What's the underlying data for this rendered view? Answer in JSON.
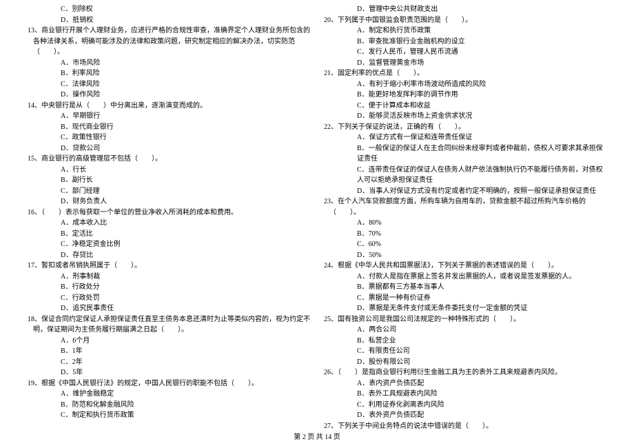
{
  "left": {
    "opts_pre": [
      "C．别除权",
      "D．抵销权"
    ],
    "q13": {
      "stem": "13、商业银行开展个人理财业务，应进行严格的合规性审查，准确界定个人理财业务所包含的各种法律关系，明确可能涉及的法律和政策问题，研究制定相应的解决办法，切实防范（　　）。",
      "opts": [
        "A．市场风险",
        "B．利率风险",
        "C．法律风险",
        "D．操作风险"
      ]
    },
    "q14": {
      "stem": "14、中央银行是从（　　）中分离出来，逐渐演变而成的。",
      "opts": [
        "A．早期银行",
        "B．现代商业银行",
        "C．政策性银行",
        "D．贷款公司"
      ]
    },
    "q15": {
      "stem": "15、商业银行的高级管理层不包括（　　）。",
      "opts": [
        "A．行长",
        "B．副行长",
        "C．部门经理",
        "D．财务负责人"
      ]
    },
    "q16": {
      "stem": "16、（　　）表示每获取一个单位的营业净收入所消耗的成本和费用。",
      "opts": [
        "A．成本收入比",
        "B．定活比",
        "C．净稳定资金比例",
        "D．存贷比"
      ]
    },
    "q17": {
      "stem": "17、暂扣或者吊销执照属于（　　）。",
      "opts": [
        "A．刑事制裁",
        "B．行政处分",
        "C．行政处罚",
        "D．追究民事责任"
      ]
    },
    "q18": {
      "stem": "18、保证合同约定保证人承担保证责任直至主债务本息还清时为止等类似内容的，视为约定不明，保证期间为主债务履行期届满之日起（　　）。",
      "opts": [
        "A．6个月",
        "B．1年",
        "C．2年",
        "D．5年"
      ]
    },
    "q19": {
      "stem": "19、根据《中国人民银行法》的规定，中国人民银行的职能不包括（　　）。",
      "opts": [
        "A．维护金融稳定",
        "B．防范和化解金融风险",
        "C．制定和执行货币政策"
      ]
    }
  },
  "right": {
    "opt_pre": "D．管理中央公共财政支出",
    "q20": {
      "stem": "20、下列属于中国银监会职责范围的是（　　）。",
      "opts": [
        "A．制定和执行货币政策",
        "B．审查批准银行业金融机构的设立",
        "C．发行人民币，管理人民币流通",
        "D．监督管理黄金市场"
      ]
    },
    "q21": {
      "stem": "21、固定利率的优点是（　　）。",
      "opts": [
        "A．有利于缩小利率市场波动所造成的风险",
        "B．能更好地发挥利率的调节作用",
        "C．便于计算成本和收益",
        "D．能够灵活反映市场上资金供求状况"
      ]
    },
    "q22": {
      "stem": "22、下列关于保证的说法，正确的有（　　）。",
      "opts": [
        "A．保证方式有一保证和连带责任保证",
        "B．一般保证的保证人在主合同纠纷未经审判或者仲裁前，债权人可要求其承担保证责任",
        "C．连带责任保证的保证人在债务人财产依法强制执行仍不能履行债务前，对债权人可以拒绝承担保证责任",
        "D．当事人对保证方式没有约定或者约定不明确的，按照一般保证承担保证责任"
      ]
    },
    "q23": {
      "stem": "23、在个人汽车贷款额度方面，所购车辆为自用车的，贷款金额不超过所购汽车价格的（　　）。",
      "opts": [
        "A．80%",
        "B．70%",
        "C．60%",
        "D．50%"
      ]
    },
    "q24": {
      "stem": "24、根据《中华人民共和国票据法》，下列关于票据的表述错误的是（　　）。",
      "opts": [
        "A．付款人是指在票据上签名并发出票据的人，或者说是签发票据的人。",
        "B．票据都有三方基本当事人",
        "C．票据是一种有价证券",
        "D．票据是无条件支付或无条件委托支付一定金额的凭证"
      ]
    },
    "q25": {
      "stem": "25、国有独资公司是我国公司法规定的一种特殊形式的（　　）。",
      "opts": [
        "A．两合公司",
        "B．私营企业",
        "C．有限责任公司",
        "D．股份有限公司"
      ]
    },
    "q26": {
      "stem": "26、（　　）是指商业银行利用衍生金融工具为主的表外工具来规避表内风险。",
      "opts": [
        "A．表内资产负债匹配",
        "B．表外工具规避表内风险",
        "C．利用证券化剥离表内风险",
        "D．表外资产负债匹配"
      ]
    },
    "q27": {
      "stem": "27、下列关于中间业务特点的说法中错误的是（　　）。"
    }
  },
  "footer": "第 2 页 共 14 页"
}
